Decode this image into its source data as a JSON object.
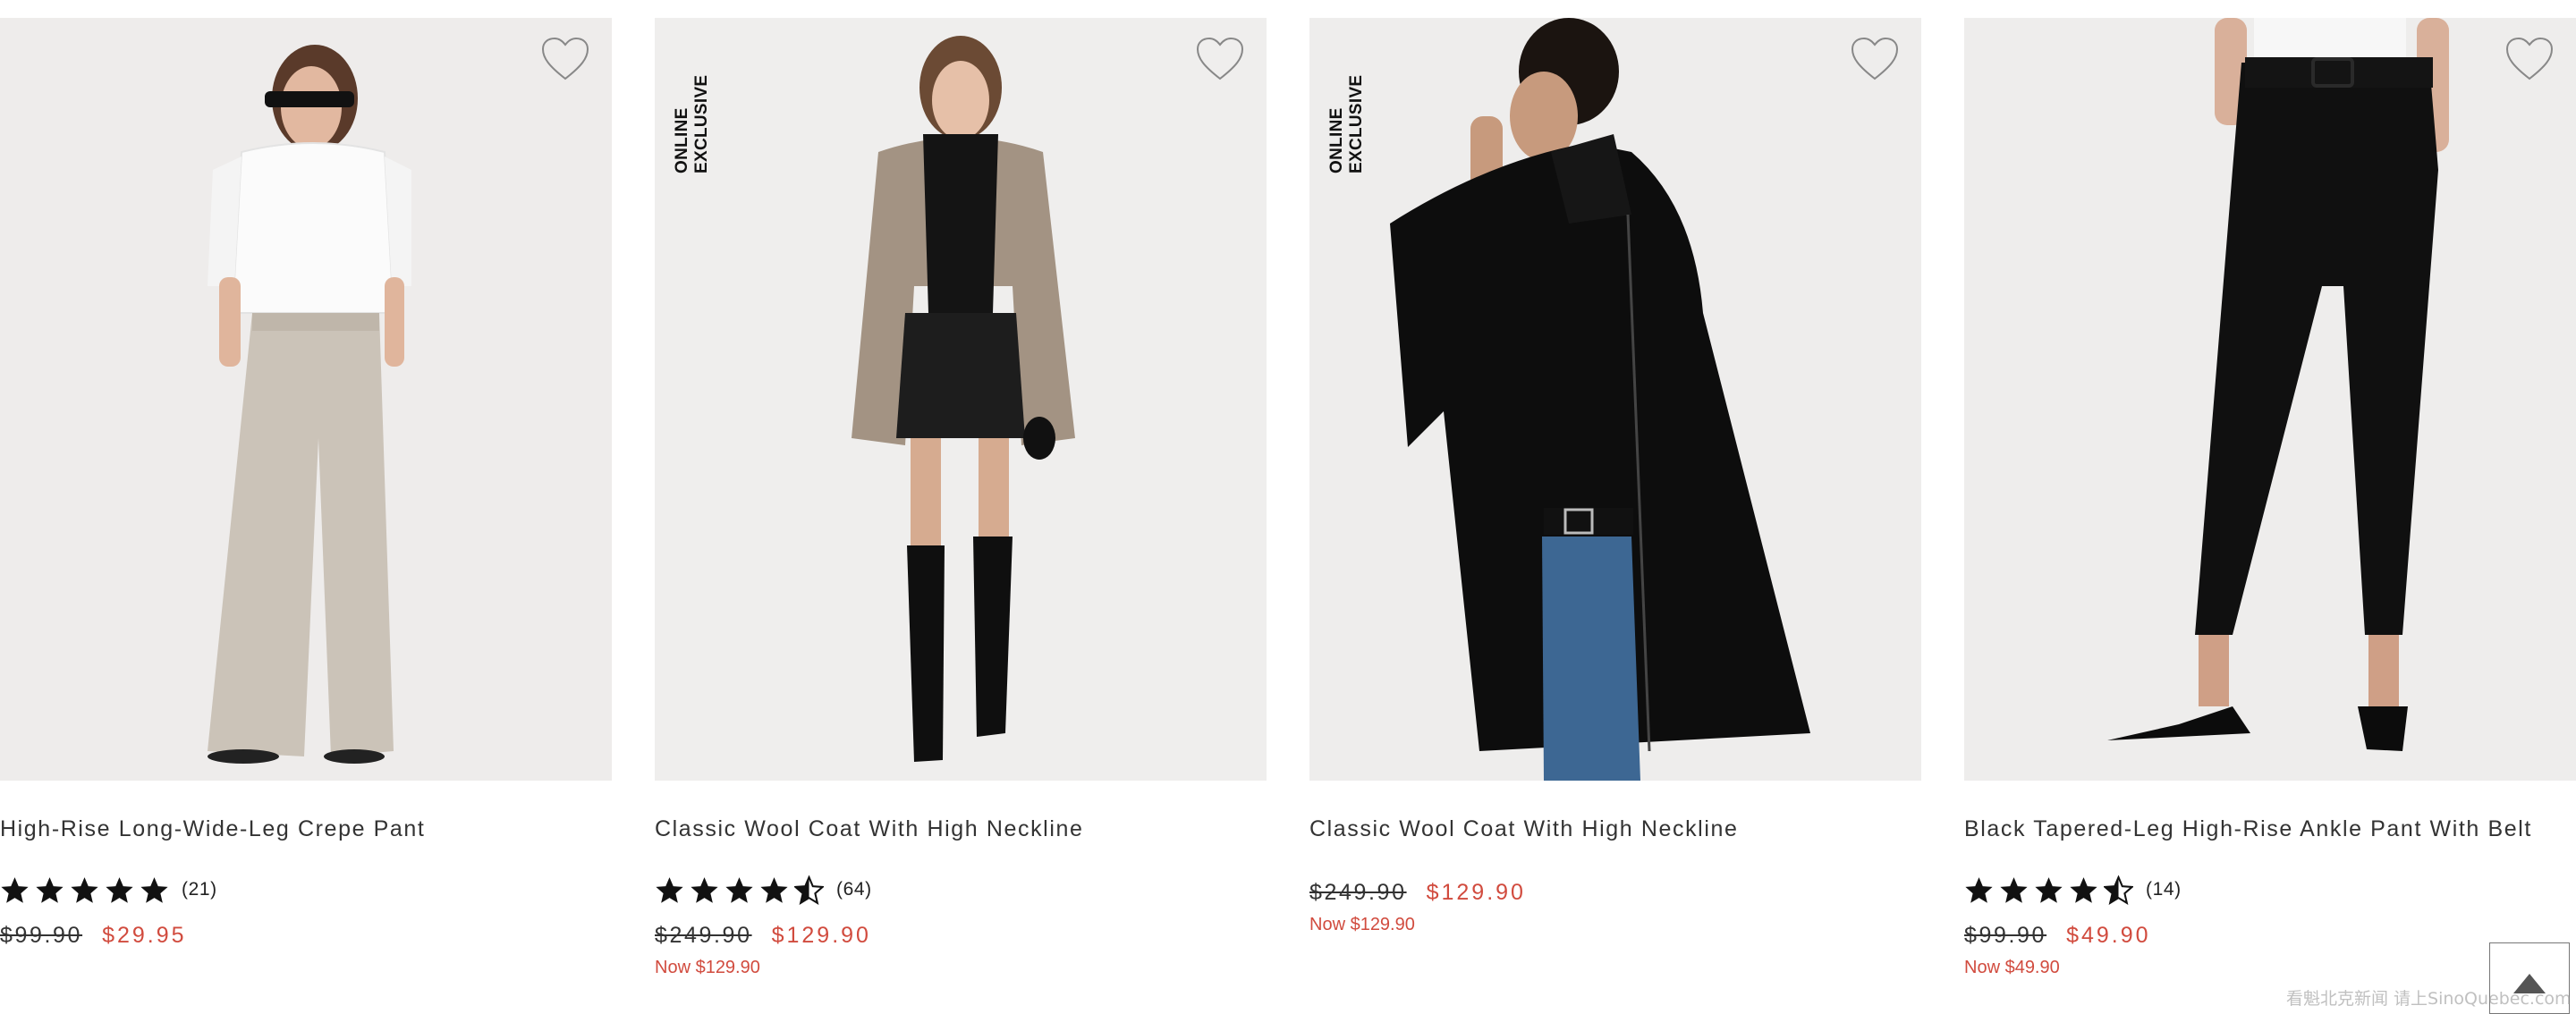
{
  "products": [
    {
      "name": "High-Rise Long-Wide-Leg Crepe Pant",
      "badge": "",
      "rating": 5,
      "review_count": "(21)",
      "old_price": "$99.90",
      "sale_price": "$29.95",
      "now_text": "",
      "photo": "model in white shirt and beige wide-leg pants"
    },
    {
      "name": "Classic Wool Coat With High Neckline",
      "badge": "ONLINE EXCLUSIVE",
      "rating": 4.5,
      "review_count": "(64)",
      "old_price": "$249.90",
      "sale_price": "$129.90",
      "now_text": "Now $129.90",
      "photo": "model in beige wool coat with black skirt and boots"
    },
    {
      "name": "Classic Wool Coat With High Neckline",
      "badge": "ONLINE EXCLUSIVE",
      "rating": null,
      "review_count": "",
      "old_price": "$249.90",
      "sale_price": "$129.90",
      "now_text": "Now $129.90",
      "photo": "model in black wool coat with jeans"
    },
    {
      "name": "Black Tapered-Leg High-Rise Ankle Pant With Belt",
      "badge": "",
      "rating": 4.5,
      "review_count": "(14)",
      "old_price": "$99.90",
      "sale_price": "$49.90",
      "now_text": "Now $49.90",
      "photo": "black tapered pants with belt and heels"
    }
  ],
  "watermark": "看魁北克新闻 请上SinoQuebec.com",
  "icons": {
    "wishlist": "heart-icon",
    "rating": "star-icon",
    "back_to_top": "triangle-up-icon"
  },
  "colors": {
    "sale": "#d14b3e",
    "text": "#333333",
    "image_bg": "#efedec"
  }
}
